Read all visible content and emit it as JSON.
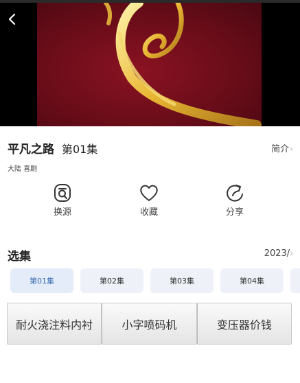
{
  "header": {
    "back_icon": "chevron-left-icon"
  },
  "show": {
    "title": "平凡之路",
    "episode": "第01集",
    "intro_label": "简介",
    "tags": "大陆 喜剧"
  },
  "actions": [
    {
      "label": "换源",
      "icon": "switch-source-icon"
    },
    {
      "label": "收藏",
      "icon": "heart-icon"
    },
    {
      "label": "分享",
      "icon": "share-icon"
    }
  ],
  "episodes": {
    "title": "选集",
    "year": "2023/",
    "items": [
      "第01集",
      "第02集",
      "第03集",
      "第04集"
    ]
  },
  "ads": [
    "耐火浇注料内衬",
    "小字喷码机",
    "变压器价钱"
  ],
  "colors": {
    "active_episode": "#3a6fb0",
    "episode_bg": "#eef2f8",
    "video_red": "#6a0d19",
    "gold": "#e0b03a"
  }
}
